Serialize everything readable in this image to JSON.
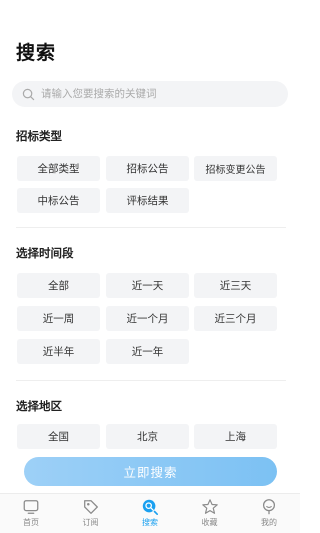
{
  "page": {
    "title": "搜索"
  },
  "search": {
    "placeholder": "请输入您要搜索的关键词"
  },
  "bid_type": {
    "title": "招标类型",
    "options": [
      "全部类型",
      "招标公告",
      "招标变更公告",
      "中标公告",
      "评标结果"
    ]
  },
  "time_range": {
    "title": "选择时间段",
    "options": [
      "全部",
      "近一天",
      "近三天",
      "近一周",
      "近一个月",
      "近三个月",
      "近半年",
      "近一年"
    ]
  },
  "region": {
    "title": "选择地区",
    "options": [
      "全国",
      "北京",
      "上海"
    ]
  },
  "submit": {
    "label": "立即搜索"
  },
  "tabbar": {
    "items": [
      {
        "label": "首页",
        "icon": "home-icon"
      },
      {
        "label": "订阅",
        "icon": "tag-icon"
      },
      {
        "label": "搜索",
        "icon": "search-icon"
      },
      {
        "label": "收藏",
        "icon": "star-icon"
      },
      {
        "label": "我的",
        "icon": "user-icon"
      }
    ],
    "active": "搜索"
  },
  "colors": {
    "accent": "#1aa0f0",
    "button": "#8ccaf5",
    "chip_bg": "#f3f4f6"
  }
}
